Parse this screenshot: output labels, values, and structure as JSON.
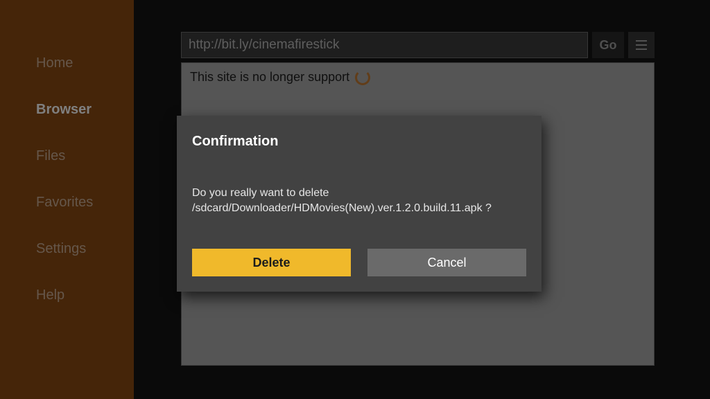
{
  "sidebar": {
    "items": [
      {
        "label": "Home"
      },
      {
        "label": "Browser"
      },
      {
        "label": "Files"
      },
      {
        "label": "Favorites"
      },
      {
        "label": "Settings"
      },
      {
        "label": "Help"
      }
    ],
    "active_index": 1
  },
  "addressbar": {
    "url": "http://bit.ly/cinemafirestick",
    "go_label": "Go"
  },
  "page": {
    "status_text": "This site is no longer support"
  },
  "dialog": {
    "title": "Confirmation",
    "message": "Do you really want to delete /sdcard/Downloader/HDMovies(New).ver.1.2.0.build.11.apk ?",
    "primary_label": "Delete",
    "secondary_label": "Cancel"
  }
}
